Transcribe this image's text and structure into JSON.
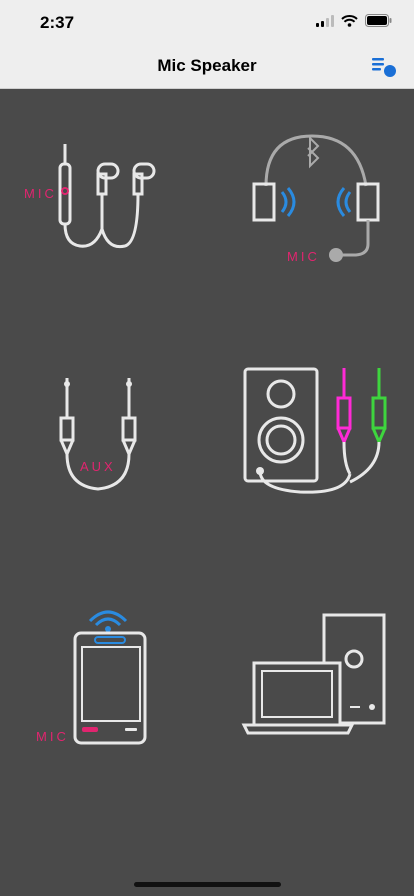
{
  "status": {
    "time": "2:37"
  },
  "nav": {
    "title": "Mic Speaker",
    "menu_icon": "playlist-icon"
  },
  "options": [
    {
      "id": "earphones",
      "label": "MIC"
    },
    {
      "id": "bluetooth-headphones",
      "label": "MIC"
    },
    {
      "id": "aux-cable",
      "label": "AUX"
    },
    {
      "id": "speaker-cable",
      "label": ""
    },
    {
      "id": "phone-wifi",
      "label": "MIC"
    },
    {
      "id": "computer",
      "label": ""
    }
  ],
  "colors": {
    "background": "#4a4a4a",
    "accent_pink": "#e0256f",
    "accent_blue": "#2a8be0",
    "accent_magenta": "#ff2ad6",
    "accent_green": "#3ed53e",
    "line": "#e8e8e8"
  }
}
